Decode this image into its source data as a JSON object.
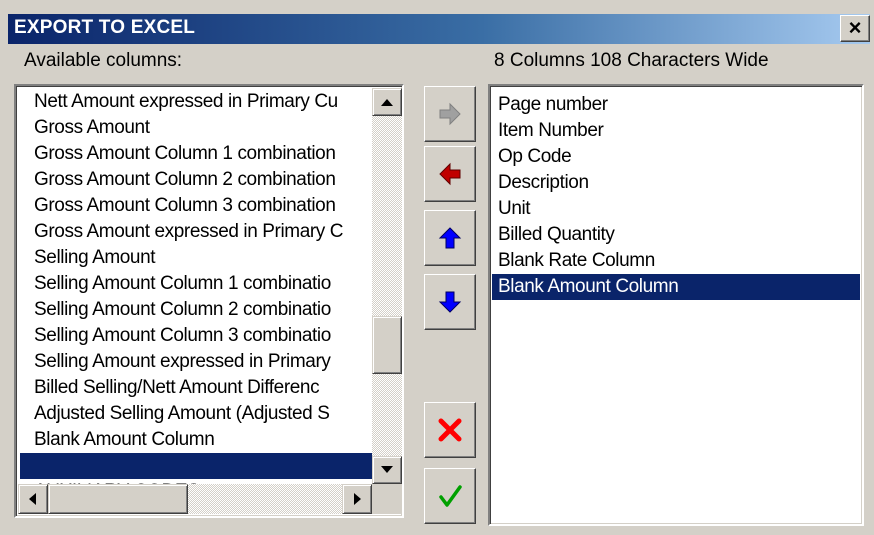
{
  "window": {
    "title": "EXPORT TO EXCEL",
    "close_label": "×"
  },
  "available": {
    "label": "Available columns:",
    "items": [
      "Nett Amount expressed in Primary Cu",
      "Gross Amount",
      "Gross Amount Column 1 combination",
      "Gross Amount Column 2 combination",
      "Gross Amount Column 3 combination",
      "Gross Amount expressed in Primary C",
      "Selling Amount",
      "Selling Amount Column 1 combinatio",
      "Selling Amount Column 2 combinatio",
      "Selling Amount Column 3 combinatio",
      "Selling Amount expressed in Primary",
      "Billed Selling/Nett Amount Differenc",
      "Adjusted Selling Amount  (Adjusted S",
      "Blank Amount Column",
      "",
      "AUXILIARY CODES"
    ],
    "selected_index": 14
  },
  "selected": {
    "label": "8 Columns 108 Characters Wide",
    "items": [
      "Page number",
      "Item Number",
      "Op Code",
      "Description",
      "Unit",
      "Billed Quantity",
      "Blank Rate Column",
      "Blank Amount Column"
    ],
    "selected_index": 7
  },
  "buttons": {
    "add": "arrow-right-icon",
    "remove": "arrow-left-icon",
    "move_up": "arrow-up-icon",
    "move_down": "arrow-down-icon",
    "delete": "red-x-icon",
    "ok": "green-check-icon"
  },
  "colors": {
    "title_bar": "#0a246a",
    "selection": "#0a246a",
    "remove_arrow": "#c00000",
    "move_arrows": "#0000ff",
    "delete_x": "#ff0000",
    "check": "#00a000"
  }
}
